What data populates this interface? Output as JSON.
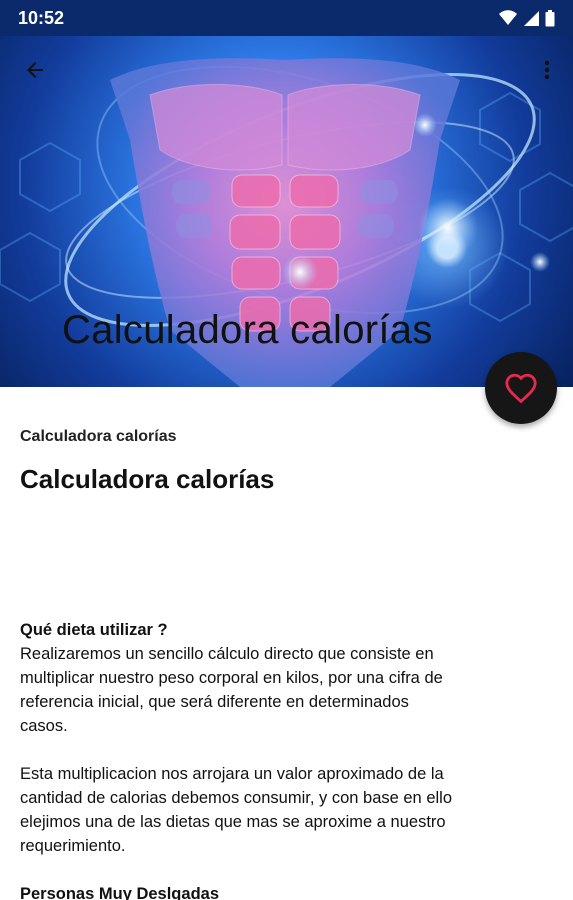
{
  "status_bar": {
    "time": "10:52",
    "icons": [
      "wifi-icon",
      "signal-icon",
      "battery-icon"
    ]
  },
  "hero": {
    "title": "Calculadora calorías",
    "accent": "#1e5fd6"
  },
  "toolbar": {
    "back_icon": "arrow-back-icon",
    "menu_icon": "more-vert-icon"
  },
  "fab": {
    "icon": "heart-outline-icon",
    "icon_color": "#e8294f"
  },
  "content": {
    "subtitle": "Calculadora calorías",
    "title": "Calculadora calorías",
    "section1_heading": "Qué dieta utilizar ?",
    "section1_lines": [
      "Realizaremos un sencillo cálculo directo que consiste en",
      "multiplicar nuestro peso corporal en kilos, por una cifra de",
      "referencia inicial, que será diferente en determinados",
      "casos."
    ],
    "section2_lines": [
      "Esta multiplicacion nos arrojara un valor aproximado de la",
      "cantidad de calorias debemos consumir, y con base en ello",
      "elejimos una de las dietas que mas se aproxime a nuestro",
      "requerimiento."
    ],
    "section3_heading": "Personas Muy Deslgadas"
  }
}
